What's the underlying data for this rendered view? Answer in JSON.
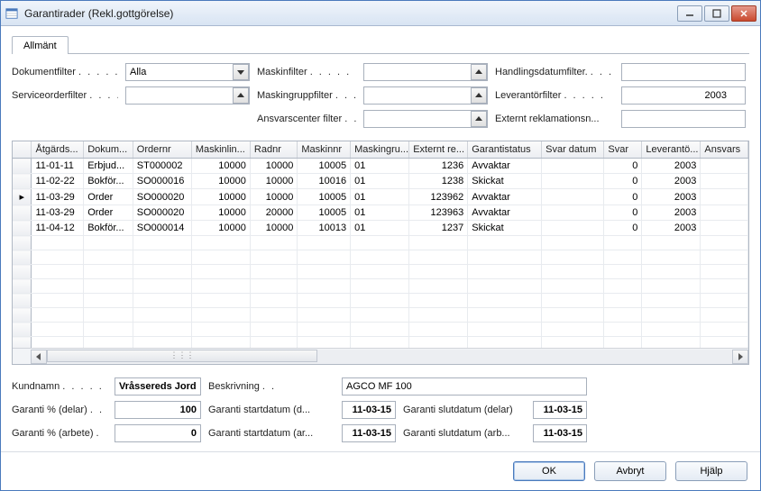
{
  "window": {
    "title": "Garantirader (Rekl.gottgörelse)"
  },
  "tabs": {
    "general": "Allmänt"
  },
  "filters": {
    "dokumentfilter_label": "Dokumentfilter",
    "dokumentfilter_value": "Alla",
    "serviceorderfilter_label": "Serviceorderfilter",
    "serviceorderfilter_value": "",
    "maskinfilter_label": "Maskinfilter",
    "maskinfilter_value": "",
    "maskingruppfilter_label": "Maskingruppfilter",
    "maskingruppfilter_value": "",
    "ansvarscenterfilter_label": "Ansvarscenter filter",
    "ansvarscenterfilter_value": "",
    "handlingsdatumfilter_label": "Handlingsdatumfilter.",
    "handlingsdatumfilter_value": "",
    "leverantorfilter_label": "Leverantörfilter",
    "leverantorfilter_value": "2003",
    "externtrek_label": "Externt reklamationsn...",
    "externtrek_value": ""
  },
  "table": {
    "headers": [
      "",
      "Åtgärds...",
      "Dokum...",
      "Ordernr",
      "Maskinlin...",
      "Radnr",
      "Maskinnr",
      "Maskingru...",
      "Externt re...",
      "Garantistatus",
      "Svar datum",
      "Svar",
      "Leverantö...",
      "Ansvars"
    ],
    "rows": [
      {
        "marker": "",
        "atgard": "11-01-11",
        "dokum": "Erbjud...",
        "ordernr": "ST000002",
        "maskinlin": "10000",
        "radnr": "10000",
        "maskinnr": "10005",
        "maskingru": "01",
        "externt": "1236",
        "garantistatus": "Avvaktar",
        "svardatum": "",
        "svar": "0",
        "leveranto": "2003",
        "ansvars": ""
      },
      {
        "marker": "",
        "atgard": "11-02-22",
        "dokum": "Bokför...",
        "ordernr": "SO000016",
        "maskinlin": "10000",
        "radnr": "10000",
        "maskinnr": "10016",
        "maskingru": "01",
        "externt": "1238",
        "garantistatus": "Skickat",
        "svardatum": "",
        "svar": "0",
        "leveranto": "2003",
        "ansvars": ""
      },
      {
        "marker": "▸",
        "atgard": "11-03-29",
        "dokum": "Order",
        "ordernr": "SO000020",
        "maskinlin": "10000",
        "radnr": "10000",
        "maskinnr": "10005",
        "maskingru": "01",
        "externt": "123962",
        "garantistatus": "Avvaktar",
        "svardatum": "",
        "svar": "0",
        "leveranto": "2003",
        "ansvars": ""
      },
      {
        "marker": "",
        "atgard": "11-03-29",
        "dokum": "Order",
        "ordernr": "SO000020",
        "maskinlin": "10000",
        "radnr": "20000",
        "maskinnr": "10005",
        "maskingru": "01",
        "externt": "123963",
        "garantistatus": "Avvaktar",
        "svardatum": "",
        "svar": "0",
        "leveranto": "2003",
        "ansvars": ""
      },
      {
        "marker": "",
        "atgard": "11-04-12",
        "dokum": "Bokför...",
        "ordernr": "SO000014",
        "maskinlin": "10000",
        "radnr": "10000",
        "maskinnr": "10013",
        "maskingru": "01",
        "externt": "1237",
        "garantistatus": "Skickat",
        "svardatum": "",
        "svar": "0",
        "leveranto": "2003",
        "ansvars": ""
      }
    ]
  },
  "details": {
    "kundnamn_label": "Kundnamn",
    "kundnamn_value": "Vråssereds Jord...",
    "beskrivning_label": "Beskrivning",
    "beskrivning_value": "AGCO MF 100",
    "garanti_delar_label": "Garanti % (delar)",
    "garanti_delar_value": "100",
    "garanti_startdatum_d_label": "Garanti startdatum (d...",
    "garanti_startdatum_d_value": "11-03-15",
    "garanti_slutdatum_delar_label": "Garanti slutdatum (delar)",
    "garanti_slutdatum_delar_value": "11-03-15",
    "garanti_arbete_label": "Garanti % (arbete)",
    "garanti_arbete_value": "0",
    "garanti_startdatum_ar_label": "Garanti startdatum (ar...",
    "garanti_startdatum_ar_value": "11-03-15",
    "garanti_slutdatum_arb_label": "Garanti slutdatum (arb...",
    "garanti_slutdatum_arb_value": "11-03-15"
  },
  "buttons": {
    "ok": "OK",
    "cancel": "Avbryt",
    "help": "Hjälp"
  }
}
